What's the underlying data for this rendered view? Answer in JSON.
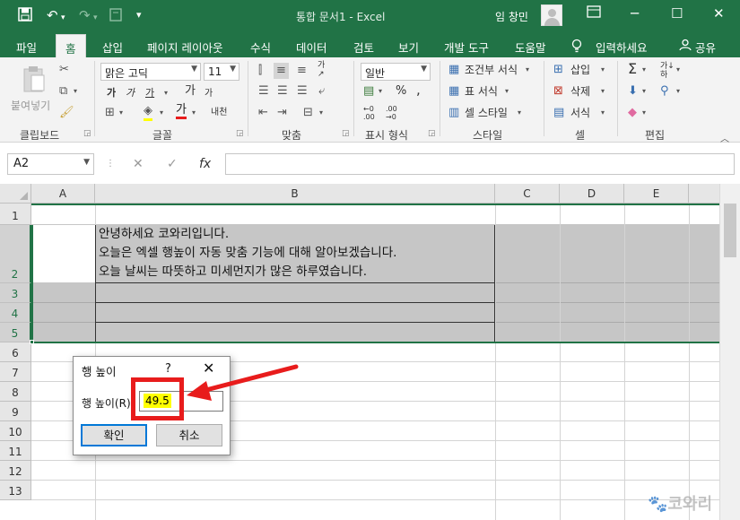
{
  "titlebar": {
    "title": "통합 문서1  -  Excel",
    "user": "임 창민",
    "qat": {
      "save": "save-icon",
      "undo": "undo-icon",
      "redo": "redo-icon",
      "touch": "touch-mode-icon",
      "customize": "customize-icon"
    },
    "window_buttons": {
      "ribbon_display": "ribbon-display-icon",
      "minimize": "─",
      "maximize": "☐",
      "close": "✕"
    }
  },
  "tabs": [
    "파일",
    "홈",
    "삽입",
    "페이지 레이아웃",
    "수식",
    "데이터",
    "검토",
    "보기",
    "개발 도구",
    "도움말"
  ],
  "active_tab": "홈",
  "tell_me": "입력하세요",
  "share": "공유",
  "ribbon": {
    "clipboard": {
      "label": "클립보드",
      "paste": "붙여넣기"
    },
    "font": {
      "label": "글꼴",
      "name": "맑은 고딕",
      "size": "11",
      "bold": "가",
      "italic": "가",
      "underline": "가",
      "grow": "가",
      "shrink": "가",
      "phonetic": "내천"
    },
    "alignment": {
      "label": "맞춤"
    },
    "number": {
      "label": "표시 형식",
      "format": "일반",
      "percent": "%"
    },
    "styles": {
      "label": "스타일",
      "conditional": "조건부 서식",
      "table": "표 서식",
      "cell": "셀 스타일"
    },
    "cells": {
      "label": "셀",
      "insert": "삽입",
      "delete": "삭제",
      "format": "서식"
    },
    "editing": {
      "label": "편집"
    }
  },
  "formula_bar": {
    "name_box": "A2",
    "cancel": "✕",
    "enter": "✓",
    "fx": "fx",
    "formula": ""
  },
  "columns": [
    "A",
    "B",
    "C",
    "D",
    "E"
  ],
  "rows": [
    "1",
    "2",
    "3",
    "4",
    "5",
    "6",
    "7",
    "8",
    "9",
    "10",
    "11",
    "12",
    "13"
  ],
  "cell_b2": [
    "안녕하세요 코와리입니다.",
    "오늘은 엑셀 행높이 자동 맞춤 기능에 대해 알아보겠습니다.",
    "오늘 날씨는 따뜻하고 미세먼지가 많은 하루였습니다."
  ],
  "dialog": {
    "title": "행 높이",
    "help": "?",
    "close": "✕",
    "label": "행 높이(R):",
    "value": "49.5",
    "ok": "확인",
    "cancel": "취소"
  },
  "annotation_color": "#e81c1c",
  "accent_color": "#217346",
  "watermark": "코와리"
}
